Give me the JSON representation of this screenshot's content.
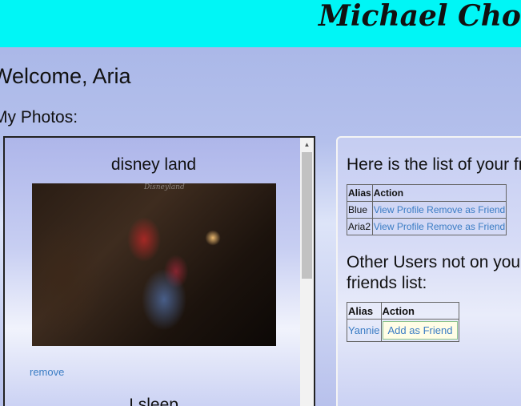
{
  "header": {
    "site_title": "Michael Choista"
  },
  "welcome": {
    "text": "Welcome, Aria"
  },
  "photos": {
    "heading": "My Photos:",
    "items": [
      {
        "title": "disney land",
        "watermark": "Disneyland",
        "remove_label": "remove"
      },
      {
        "title": "I sleep"
      }
    ]
  },
  "friends": {
    "heading": "Here is the list of your friends:",
    "columns": [
      "Alias",
      "Action"
    ],
    "rows": [
      {
        "alias": "Blue",
        "view_label": "View Profile",
        "remove_label": "Remove as Friend"
      },
      {
        "alias": "Aria2",
        "view_label": "View Profile",
        "remove_label": "Remove as Friend"
      }
    ]
  },
  "others": {
    "heading": "Other Users not on your friends list:",
    "columns": [
      "Alias",
      "Action"
    ],
    "rows": [
      {
        "alias": "Yannie",
        "add_label": "Add as Friend"
      }
    ]
  },
  "colors": {
    "header_bg": "#00f6f6",
    "link": "#3a7cc4",
    "add_button_bg": "#fffde6"
  }
}
